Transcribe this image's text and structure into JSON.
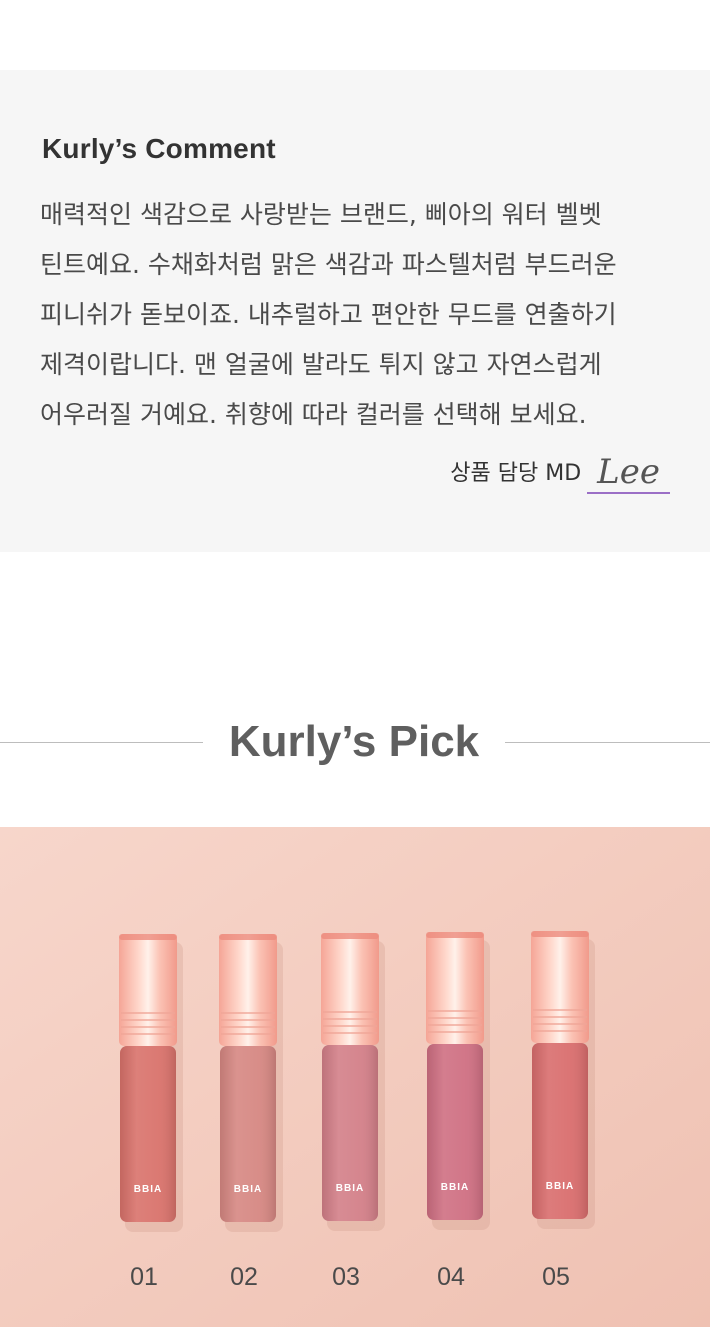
{
  "comment": {
    "title": "Kurly’s Comment",
    "lines": [
      "매력적인 색감으로 사랑받는 브랜드, 삐아의 워터 벨벳",
      "틴트예요. 수채화처럼 맑은 색감과 파스텔처럼 부드러운",
      "피니쉬가 돋보이죠. 내추럴하고 편안한 무드를 연출하기",
      "제격이랍니다. 맨 얼굴에 발라도 튀지 않고 자연스럽게",
      "어우러질 거예요. 취향에 따라 컬러를 선택해 보세요."
    ],
    "signature_label": "상품 담당 MD",
    "signature_name": "Lee"
  },
  "pick": {
    "title": "Kurly’s Pick"
  },
  "products": [
    {
      "number": "01",
      "brand": "BBIA",
      "color": "#d9726b"
    },
    {
      "number": "02",
      "brand": "BBIA",
      "color": "#d68782"
    },
    {
      "number": "03",
      "brand": "BBIA",
      "color": "#d37f88"
    },
    {
      "number": "04",
      "brand": "BBIA",
      "color": "#cf6f82"
    },
    {
      "number": "05",
      "brand": "BBIA",
      "color": "#d96d6d"
    }
  ],
  "colors": {
    "comment_bg": "#f6f6f6",
    "signature_underline": "#9b6fc6",
    "photo_bg": "#f3c8ba",
    "cap": "#f7b5a9"
  }
}
